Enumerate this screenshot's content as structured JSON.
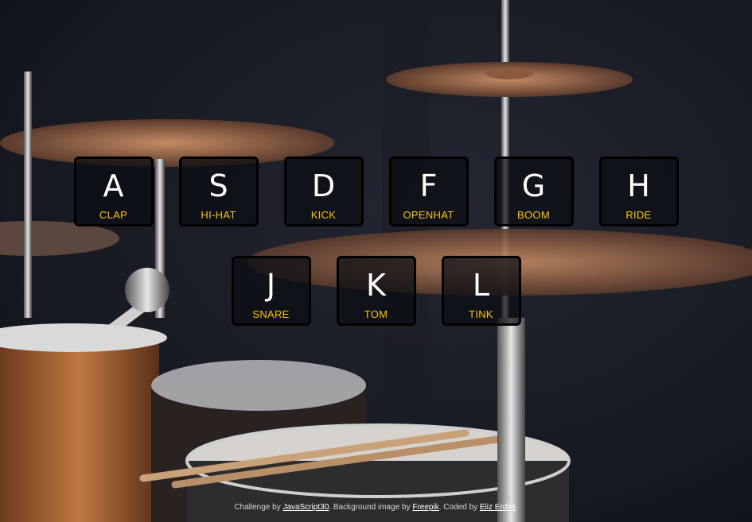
{
  "keys": [
    {
      "letter": "A",
      "sound": "CLAP"
    },
    {
      "letter": "S",
      "sound": "HI-HAT"
    },
    {
      "letter": "D",
      "sound": "KICK"
    },
    {
      "letter": "F",
      "sound": "OPENHAT"
    },
    {
      "letter": "G",
      "sound": "BOOM"
    },
    {
      "letter": "H",
      "sound": "RIDE"
    },
    {
      "letter": "J",
      "sound": "SNARE"
    },
    {
      "letter": "K",
      "sound": "TOM"
    },
    {
      "letter": "L",
      "sound": "TINK"
    }
  ],
  "footer": {
    "prefix": "Challenge by ",
    "challenge_link": "JavaScript30",
    "mid1": ". Background image by ",
    "image_link": "Freepik",
    "mid2": ". Coded by ",
    "author_link": "Eliz Erdim",
    "suffix": "."
  },
  "colors": {
    "accent": "#ffc600",
    "key_text": "#ffffff",
    "key_border": "#000000"
  }
}
